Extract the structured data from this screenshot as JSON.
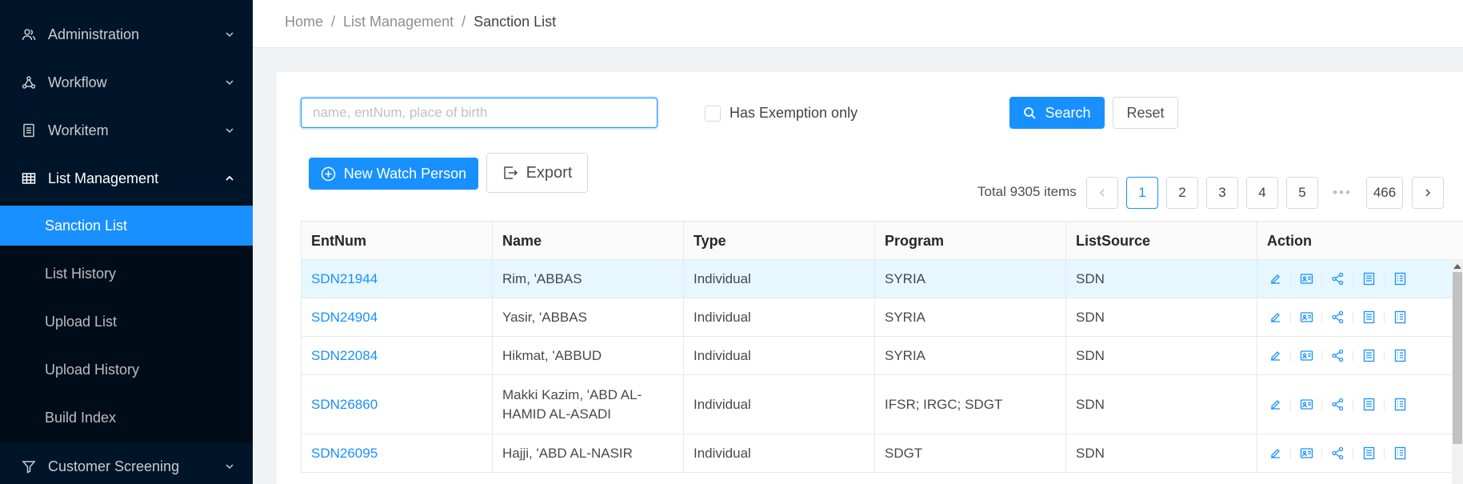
{
  "sidebar": {
    "menus": [
      {
        "label": "Administration",
        "icon": "user-group-icon"
      },
      {
        "label": "Workflow",
        "icon": "workflow-icon"
      },
      {
        "label": "Workitem",
        "icon": "document-icon"
      },
      {
        "label": "List Management",
        "icon": "table-icon"
      }
    ],
    "sub_items": [
      {
        "label": "Sanction List",
        "active": true
      },
      {
        "label": "List History"
      },
      {
        "label": "Upload List"
      },
      {
        "label": "Upload History"
      },
      {
        "label": "Build Index"
      }
    ],
    "bottom_menu": {
      "label": "Customer Screening",
      "icon": "filter-icon"
    }
  },
  "breadcrumb": [
    "Home",
    "List Management",
    "Sanction List"
  ],
  "search": {
    "placeholder": "name, entNum, place of birth",
    "value": "",
    "exemption_label": "Has Exemption only",
    "search_label": "Search",
    "reset_label": "Reset"
  },
  "toolbar": {
    "new_label": "New Watch Person",
    "export_label": "Export"
  },
  "pagination": {
    "total_text": "Total 9305 items",
    "pages": [
      "1",
      "2",
      "3",
      "4",
      "5"
    ],
    "ellipsis": "•••",
    "last": "466",
    "current": "1"
  },
  "table": {
    "headers": [
      "EntNum",
      "Name",
      "Type",
      "Program",
      "ListSource",
      "Action"
    ],
    "rows": [
      {
        "entnum": "SDN21944",
        "name": "Rim, 'ABBAS",
        "type": "Individual",
        "program": "SYRIA",
        "source": "SDN"
      },
      {
        "entnum": "SDN24904",
        "name": "Yasir, 'ABBAS",
        "type": "Individual",
        "program": "SYRIA",
        "source": "SDN"
      },
      {
        "entnum": "SDN22084",
        "name": "Hikmat, 'ABBUD",
        "type": "Individual",
        "program": "SYRIA",
        "source": "SDN"
      },
      {
        "entnum": "SDN26860",
        "name": "Makki Kazim, 'ABD AL-HAMID AL-ASADI",
        "type": "Individual",
        "program": "IFSR; IRGC; SDGT",
        "source": "SDN"
      },
      {
        "entnum": "SDN26095",
        "name": "Hajji, 'ABD AL-NASIR",
        "type": "Individual",
        "program": "SDGT",
        "source": "SDN"
      }
    ]
  },
  "colors": {
    "primary": "#1890ff",
    "sidebar": "#001529",
    "submenu": "#000c17"
  }
}
